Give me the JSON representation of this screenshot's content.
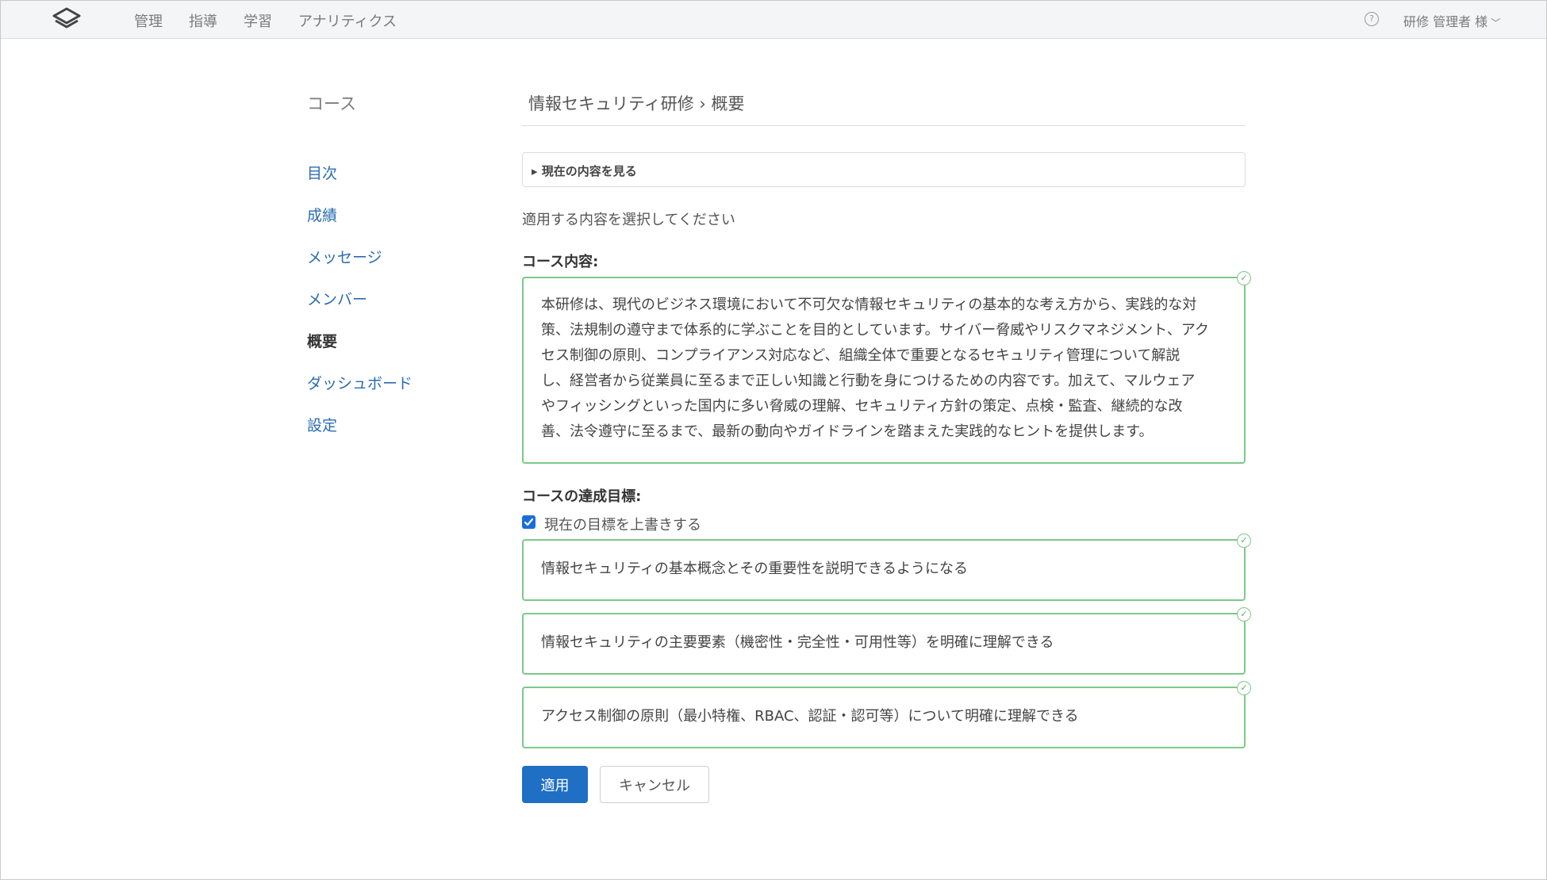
{
  "topnav": {
    "items": [
      {
        "label": "管理"
      },
      {
        "label": "指導"
      },
      {
        "label": "学習"
      },
      {
        "label": "アナリティクス"
      }
    ],
    "user_label": "研修 管理者 様"
  },
  "sidebar": {
    "title": "コース",
    "items": [
      {
        "label": "目次"
      },
      {
        "label": "成績"
      },
      {
        "label": "メッセージ"
      },
      {
        "label": "メンバー"
      },
      {
        "label": "概要"
      },
      {
        "label": "ダッシュボード"
      },
      {
        "label": "設定"
      }
    ],
    "active_index": 4
  },
  "main": {
    "breadcrumb": "情報セキュリティ研修 › 概要",
    "details_summary": "▸ 現在の内容を見る",
    "instruction": "適用する内容を選択してください",
    "course_content_label": "コース内容:",
    "course_content": [
      "本研修は、現代のビジネス環境において不可欠な情報セキュリティの基本的な考え方から、実践的な対",
      "策、法規制の遵守まで体系的に学ぶことを目的としています。サイバー脅威やリスクマネジメント、アク",
      "セス制御の原則、コンプライアンス対応など、組織全体で重要となるセキュリティ管理について解説",
      "し、経営者から従業員に至るまで正しい知識と行動を身につけるための内容です。加えて、マルウェア",
      "やフィッシングといった国内に多い脅威の理解、セキュリティ方針の策定、点検・監査、継続的な改",
      "善、法令遵守に至るまで、最新の動向やガイドラインを踏まえた実践的なヒントを提供します。"
    ],
    "goals_label": "コースの達成目標:",
    "overwrite_checkbox_label": "現在の目標を上書きする",
    "overwrite_checked": true,
    "goals": [
      "情報セキュリティの基本概念とその重要性を説明できるようになる",
      "情報セキュリティの主要要素（機密性・完全性・可用性等）を明確に理解できる",
      "アクセス制御の原則（最小特権、RBAC、認証・認可等）について明確に理解できる"
    ],
    "apply_label": "適用",
    "cancel_label": "キャンセル"
  },
  "colors": {
    "accent": "#1f6fc4",
    "link": "#2a6db0",
    "success_border": "#7dc98a"
  }
}
